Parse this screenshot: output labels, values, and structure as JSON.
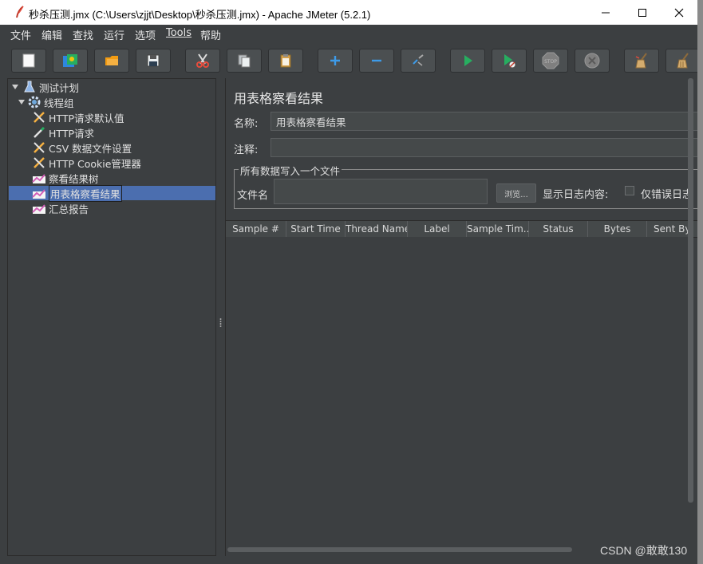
{
  "window": {
    "title": "秒杀压测.jmx (C:\\Users\\zjjt\\Desktop\\秒杀压测.jmx) - Apache JMeter (5.2.1)"
  },
  "menubar": {
    "items": [
      {
        "label": "文件"
      },
      {
        "label": "编辑"
      },
      {
        "label": "查找"
      },
      {
        "label": "运行"
      },
      {
        "label": "选项"
      },
      {
        "label": "Tools"
      },
      {
        "label": "帮助"
      }
    ]
  },
  "toolbar": {
    "buttons": [
      {
        "name": "new",
        "icon": "new-file-icon"
      },
      {
        "name": "templates",
        "icon": "templates-icon"
      },
      {
        "name": "open",
        "icon": "open-folder-icon"
      },
      {
        "name": "save",
        "icon": "save-icon"
      },
      {
        "name": "cut",
        "icon": "scissors-icon"
      },
      {
        "name": "copy",
        "icon": "copy-icon"
      },
      {
        "name": "paste",
        "icon": "paste-icon"
      },
      {
        "name": "expand",
        "icon": "plus-icon"
      },
      {
        "name": "collapse",
        "icon": "minus-icon"
      },
      {
        "name": "toggle",
        "icon": "toggle-icon"
      },
      {
        "name": "start",
        "icon": "play-icon"
      },
      {
        "name": "start-no-pauses",
        "icon": "play-no-timer-icon"
      },
      {
        "name": "stop",
        "icon": "stop-icon"
      },
      {
        "name": "shutdown",
        "icon": "shutdown-icon"
      },
      {
        "name": "clear",
        "icon": "broom-icon"
      },
      {
        "name": "clear-all",
        "icon": "broom-all-icon"
      }
    ],
    "stop_label": "STOP"
  },
  "tree": {
    "nodes": [
      {
        "label": "测试计划",
        "icon": "flask-icon",
        "level": 0,
        "expanded": true
      },
      {
        "label": "线程组",
        "icon": "gear-icon",
        "level": 1,
        "expanded": true
      },
      {
        "label": "HTTP请求默认值",
        "icon": "wrench-icon",
        "level": 2
      },
      {
        "label": "HTTP请求",
        "icon": "pipette-icon",
        "level": 2
      },
      {
        "label": "CSV 数据文件设置",
        "icon": "wrench-icon",
        "level": 2
      },
      {
        "label": "HTTP Cookie管理器",
        "icon": "wrench-icon",
        "level": 2
      },
      {
        "label": "察看结果树",
        "icon": "chart-icon",
        "level": 2
      },
      {
        "label": "用表格察看结果",
        "icon": "chart-icon",
        "level": 2,
        "selected": true
      },
      {
        "label": "汇总报告",
        "icon": "chart-icon",
        "level": 2
      }
    ]
  },
  "panel": {
    "title": "用表格察看结果",
    "name_label": "名称:",
    "name_value": "用表格察看结果",
    "comment_label": "注释:",
    "comment_value": "",
    "group_title": "所有数据写入一个文件",
    "filename_label": "文件名",
    "filename_value": "",
    "browse_label": "浏览...",
    "log_label": "显示日志内容:",
    "errors_only_label": "仅错误日志",
    "errors_only_checked": false
  },
  "table": {
    "columns": [
      "Sample #",
      "Start Time",
      "Thread Name",
      "Label",
      "Sample Tim...",
      "Status",
      "Bytes",
      "Sent By"
    ],
    "rows": []
  },
  "watermark": "CSDN @敢敢130"
}
